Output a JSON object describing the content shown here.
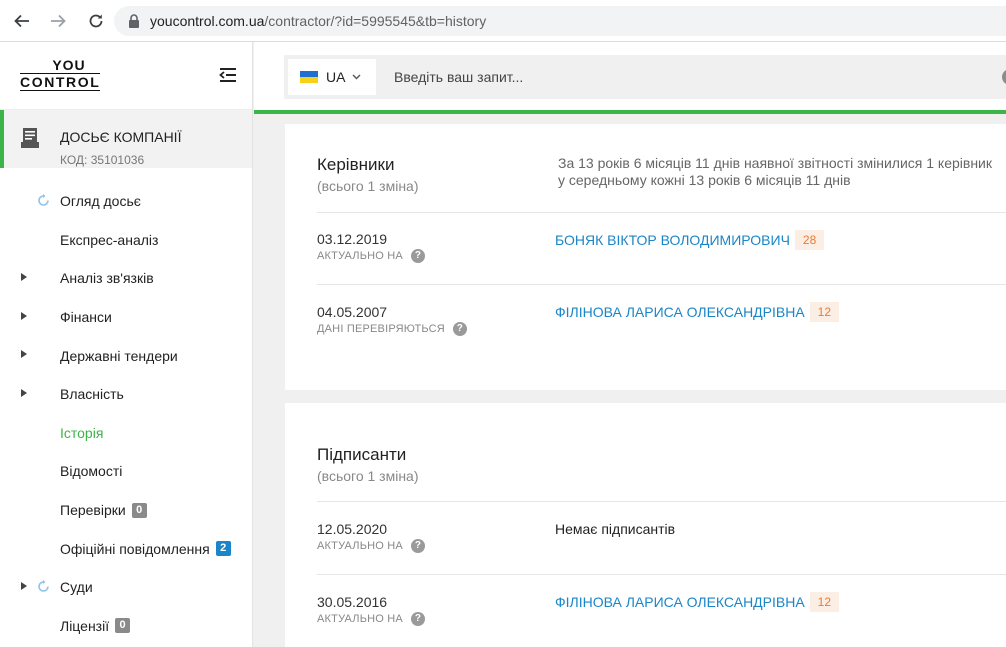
{
  "browser": {
    "url_host": "youcontrol.com.ua",
    "url_path": "/contractor/?id=5995545&tb=history"
  },
  "logo": {
    "line1": "YOU",
    "line2": "CONTROL"
  },
  "dossier": {
    "title": "ДОСЬЄ КОМПАНІЇ",
    "code": "КОД: 35101036"
  },
  "sidebar": {
    "items": [
      {
        "label": "Огляд досьє"
      },
      {
        "label": "Експрес-аналіз"
      },
      {
        "label": "Аналіз зв'язків"
      },
      {
        "label": "Фінанси"
      },
      {
        "label": "Державні тендери"
      },
      {
        "label": "Власність"
      },
      {
        "label": "Історія"
      },
      {
        "label": "Відомості"
      },
      {
        "label": "Перевірки",
        "badge": "0"
      },
      {
        "label": "Офіційні повідомлення",
        "badge": "2"
      },
      {
        "label": "Суди"
      },
      {
        "label": "Ліцензії",
        "badge": "0"
      }
    ]
  },
  "search": {
    "language": "UA",
    "placeholder": "Введіть ваш запит...",
    "help": "?"
  },
  "managers": {
    "title": "Керівники",
    "subtitle": "(всього 1 зміна)",
    "summary_line1": "За 13 років 6 місяців 11 днів наявної звітності змінилися 1 керівник",
    "summary_line2": "у середньому кожні 13 років 6 місяців 11 днів",
    "rows": [
      {
        "date": "03.12.2019",
        "status": "АКТУАЛЬНО НА",
        "name": "БОНЯК ВІКТОР ВОЛОДИМИРОВИЧ",
        "count": "28"
      },
      {
        "date": "04.05.2007",
        "status": "ДАНІ ПЕРЕВІРЯЮТЬСЯ",
        "name": "ФІЛІНОВА ЛАРИСА ОЛЕКСАНДРІВНА",
        "count": "12"
      }
    ]
  },
  "signers": {
    "title": "Підписанти",
    "subtitle": "(всього 1 зміна)",
    "rows": [
      {
        "date": "12.05.2020",
        "status": "АКТУАЛЬНО НА",
        "text": "Немає підписантів"
      },
      {
        "date": "30.05.2016",
        "status": "АКТУАЛЬНО НА",
        "name": "ФІЛІНОВА ЛАРИСА ОЛЕКСАНДРІВНА",
        "count": "12"
      }
    ]
  },
  "colors": {
    "accent_green": "#3bb54a",
    "link_blue": "#1b86c7",
    "count_orange": "#e77c3b"
  }
}
